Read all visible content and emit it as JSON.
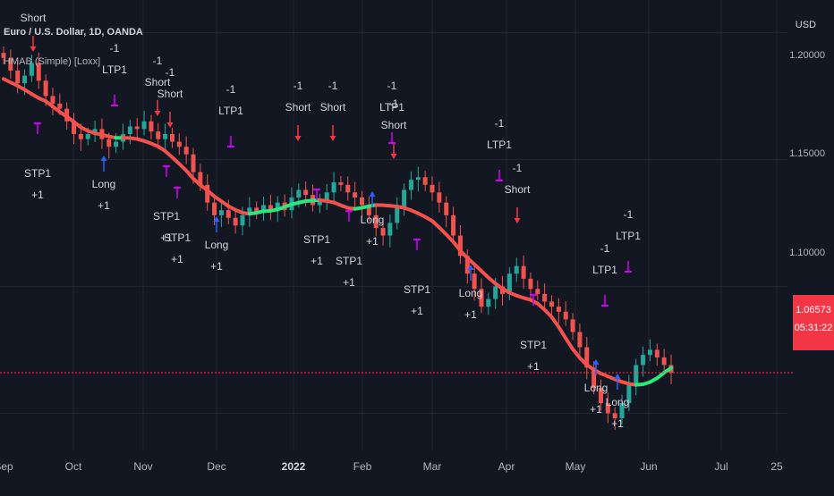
{
  "header": {
    "symbol": "Euro / U.S. Dollar, 1D, OANDA",
    "indicator": "HMAB (Simple) [Loxx]",
    "currency": "USD"
  },
  "price_badge": {
    "price": "1.06573",
    "countdown": "05:31:22",
    "color": "#f23645"
  },
  "y_axis": {
    "labels": [
      "1.20000",
      "1.15000",
      "1.10000"
    ]
  },
  "x_axis": {
    "labels": [
      {
        "text": "Sep",
        "bold": false
      },
      {
        "text": "Oct",
        "bold": false
      },
      {
        "text": "Nov",
        "bold": false
      },
      {
        "text": "Dec",
        "bold": false
      },
      {
        "text": "2022",
        "bold": true
      },
      {
        "text": "Feb",
        "bold": false
      },
      {
        "text": "Mar",
        "bold": false
      },
      {
        "text": "Apr",
        "bold": false
      },
      {
        "text": "May",
        "bold": false
      },
      {
        "text": "Jun",
        "bold": false
      },
      {
        "text": "Jul",
        "bold": false
      },
      {
        "text": "25",
        "bold": false
      }
    ]
  },
  "colors": {
    "background": "#131722",
    "up": "#26a69a",
    "down": "#ef5350",
    "ma_bull": "#2ee77c",
    "ma_bear": "#f2514d",
    "long_arrow": "#2962ff",
    "short_arrow": "#f23645",
    "tp_marker": "#d500f9",
    "grid": "#232632",
    "last_price_line": "#f23645"
  },
  "chart_data": {
    "type": "candlestick",
    "instrument": "EUR/USD",
    "timeframe": "1D",
    "ylim": [
      1.035,
      1.21
    ],
    "close": [
      1.19,
      1.185,
      1.18,
      1.183,
      1.188,
      1.181,
      1.175,
      1.172,
      1.17,
      1.165,
      1.16,
      1.158,
      1.16,
      1.162,
      1.158,
      1.155,
      1.157,
      1.16,
      1.163,
      1.162,
      1.165,
      1.161,
      1.158,
      1.16,
      1.157,
      1.155,
      1.152,
      1.145,
      1.14,
      1.133,
      1.128,
      1.13,
      1.127,
      1.124,
      1.128,
      1.131,
      1.129,
      1.132,
      1.13,
      1.133,
      1.13,
      1.135,
      1.138,
      1.136,
      1.132,
      1.134,
      1.137,
      1.141,
      1.14,
      1.137,
      1.135,
      1.132,
      1.128,
      1.123,
      1.12,
      1.125,
      1.131,
      1.138,
      1.142,
      1.143,
      1.14,
      1.137,
      1.133,
      1.128,
      1.12,
      1.112,
      1.105,
      1.099,
      1.092,
      1.095,
      1.1,
      1.097,
      1.105,
      1.108,
      1.103,
      1.099,
      1.097,
      1.094,
      1.092,
      1.09,
      1.087,
      1.082,
      1.076,
      1.068,
      1.06,
      1.054,
      1.05,
      1.048,
      1.054,
      1.061,
      1.069,
      1.073,
      1.075,
      1.072,
      1.069,
      1.066
    ],
    "signals": [
      {
        "type": "Short",
        "text": [
          "-1",
          "Short"
        ]
      },
      {
        "type": "STP1",
        "text": [
          "STP1",
          "+1"
        ]
      },
      {
        "type": "Long",
        "text": [
          "Long",
          "+1"
        ]
      },
      {
        "type": "LTP1",
        "text": [
          "-1",
          "LTP1"
        ]
      }
    ]
  }
}
